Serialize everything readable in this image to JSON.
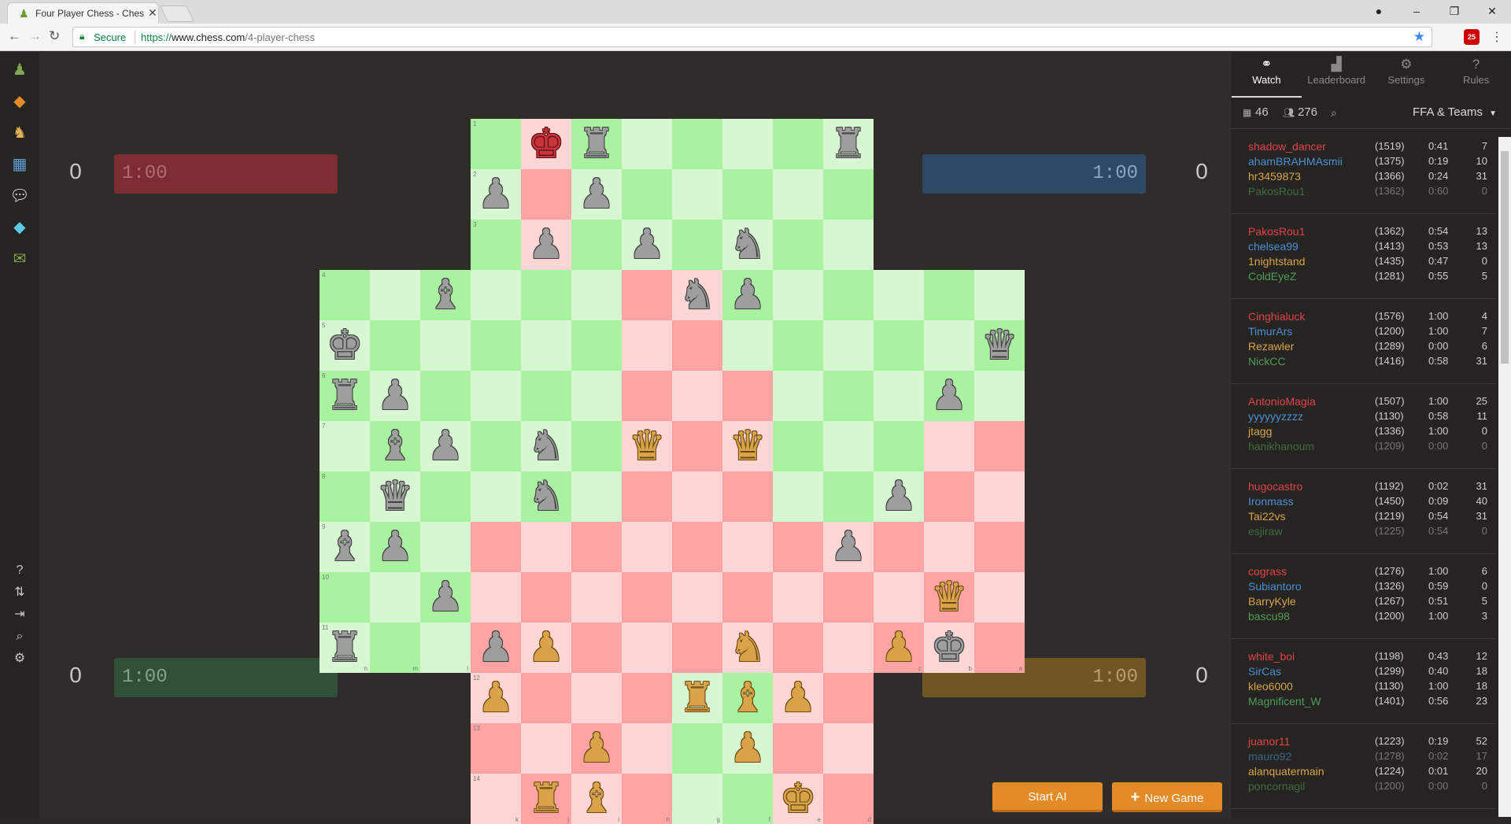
{
  "browser": {
    "tab_title": "Four Player Chess - Ches",
    "secure_label": "Secure",
    "url_scheme": "https://",
    "url_host": "www.chess.com",
    "url_path": "/4-player-chess",
    "abp_count": "25"
  },
  "scores": {
    "red": "0",
    "blue": "0",
    "green": "0",
    "yellow": "0"
  },
  "clocks": {
    "red": {
      "time": "1:00",
      "bg": "#7d2c32",
      "fg": "#b56a6f"
    },
    "blue": {
      "time": "1:00",
      "bg": "#2c4a66",
      "fg": "#88a6c2"
    },
    "green": {
      "time": "1:00",
      "bg": "#31503a",
      "fg": "#82a28c"
    },
    "yellow": {
      "time": "1:00",
      "bg": "#6e5722",
      "fg": "#b79f6b"
    }
  },
  "colors": {
    "light_green": "#d7f7d3",
    "dark_green": "#a8f2a0",
    "light_red": "#ffd6d6",
    "dark_red": "#ffa3a5",
    "accent": "#e38b26"
  },
  "buttons": {
    "start_ai": "Start AI",
    "new_game": "New Game",
    "new_game_icon": "+"
  },
  "right_tabs": [
    {
      "label": "Watch",
      "icon": "binoculars-icon",
      "glyph": "⚭"
    },
    {
      "label": "Leaderboard",
      "icon": "leaderboard-icon",
      "glyph": "▟"
    },
    {
      "label": "Settings",
      "icon": "gear-icon",
      "glyph": "⚙"
    },
    {
      "label": "Rules",
      "icon": "help-icon",
      "glyph": "?"
    }
  ],
  "stats": {
    "games": "46",
    "players": "276",
    "mode": "FFA & Teams"
  },
  "games": [
    [
      [
        "shadow_dancer",
        "(1519)",
        "0:41",
        "7"
      ],
      [
        "ahamBRAHMAsmii",
        "(1375)",
        "0:19",
        "10"
      ],
      [
        "hr3459873",
        "(1366)",
        "0:24",
        "31"
      ],
      [
        "PakosRou1",
        "(1362)",
        "0:60",
        "0"
      ]
    ],
    [
      [
        "PakosRou1",
        "(1362)",
        "0:54",
        "13"
      ],
      [
        "chelsea99",
        "(1413)",
        "0:53",
        "13"
      ],
      [
        "1nightstand",
        "(1435)",
        "0:47",
        "0"
      ],
      [
        "ColdEyeZ",
        "(1281)",
        "0:55",
        "5"
      ]
    ],
    [
      [
        "Cinghialuck",
        "(1576)",
        "1:00",
        "4"
      ],
      [
        "TimurArs",
        "(1200)",
        "1:00",
        "7"
      ],
      [
        "Rezawler",
        "(1289)",
        "0:00",
        "6"
      ],
      [
        "NickCC",
        "(1416)",
        "0:58",
        "31"
      ]
    ],
    [
      [
        "AntonioMagia",
        "(1507)",
        "1:00",
        "25"
      ],
      [
        "yyyyyyzzzz",
        "(1130)",
        "0:58",
        "11"
      ],
      [
        "jtagg",
        "(1336)",
        "1:00",
        "0"
      ],
      [
        "hanikhanoum",
        "(1209)",
        "0:00",
        "0"
      ]
    ],
    [
      [
        "hugocastro",
        "(1192)",
        "0:02",
        "31"
      ],
      [
        "Ironmass",
        "(1450)",
        "0:09",
        "40"
      ],
      [
        "Tai22vs",
        "(1219)",
        "0:54",
        "31"
      ],
      [
        "esjiraw",
        "(1225)",
        "0:54",
        "0"
      ]
    ],
    [
      [
        "cograss",
        "(1276)",
        "1:00",
        "6"
      ],
      [
        "Subiantoro",
        "(1326)",
        "0:59",
        "0"
      ],
      [
        "BarryKyle",
        "(1267)",
        "0:51",
        "5"
      ],
      [
        "bascu98",
        "(1200)",
        "1:00",
        "3"
      ]
    ],
    [
      [
        "white_boi",
        "(1198)",
        "0:43",
        "12"
      ],
      [
        "SirCas",
        "(1299)",
        "0:40",
        "18"
      ],
      [
        "kleo6000",
        "(1130)",
        "1:00",
        "18"
      ],
      [
        "Magnificent_W",
        "(1401)",
        "0:56",
        "23"
      ]
    ],
    [
      [
        "juanor11",
        "(1223)",
        "0:19",
        "52"
      ],
      [
        "mauro92",
        "(1278)",
        "0:02",
        "17"
      ],
      [
        "alanquatermain",
        "(1224)",
        "0:01",
        "20"
      ],
      [
        "poncornagil",
        "(1200)",
        "0:00",
        "0"
      ]
    ]
  ],
  "dim_rows": [
    [
      0,
      3
    ],
    [
      3,
      3
    ],
    [
      4,
      3
    ],
    [
      7,
      1
    ],
    [
      7,
      3
    ]
  ],
  "player_colors": [
    "#e0434b",
    "#4a8fd6",
    "#d9a34a",
    "#4f9c5b"
  ],
  "board": {
    "rank_labels": [
      "1",
      "2",
      "3",
      "4",
      "5",
      "6",
      "7",
      "8",
      "9",
      "10",
      "11",
      "12",
      "13",
      "14"
    ],
    "file_labels": [
      "n",
      "m",
      "l",
      "k",
      "j",
      "i",
      "h",
      "g",
      "f",
      "e",
      "d",
      "c",
      "b",
      "a"
    ],
    "pieces": [
      [
        0,
        4,
        "red",
        "king"
      ],
      [
        0,
        5,
        "grey",
        "rook"
      ],
      [
        0,
        10,
        "grey",
        "rook"
      ],
      [
        1,
        3,
        "grey",
        "pawn"
      ],
      [
        1,
        5,
        "grey",
        "pawn"
      ],
      [
        2,
        4,
        "grey",
        "pawn"
      ],
      [
        2,
        6,
        "grey",
        "pawn"
      ],
      [
        2,
        8,
        "grey",
        "knight"
      ],
      [
        3,
        2,
        "grey",
        "bishop"
      ],
      [
        3,
        7,
        "grey",
        "knight"
      ],
      [
        3,
        8,
        "grey",
        "pawn"
      ],
      [
        4,
        0,
        "grey",
        "king"
      ],
      [
        4,
        13,
        "grey",
        "queen"
      ],
      [
        5,
        0,
        "grey",
        "rook"
      ],
      [
        5,
        1,
        "grey",
        "pawn"
      ],
      [
        5,
        12,
        "grey",
        "pawn"
      ],
      [
        6,
        1,
        "grey",
        "bishop"
      ],
      [
        6,
        2,
        "grey",
        "pawn"
      ],
      [
        6,
        4,
        "grey",
        "knight"
      ],
      [
        6,
        6,
        "gold",
        "queen"
      ],
      [
        6,
        8,
        "gold",
        "queen"
      ],
      [
        7,
        1,
        "grey",
        "queen"
      ],
      [
        7,
        4,
        "grey",
        "knight"
      ],
      [
        7,
        11,
        "grey",
        "pawn"
      ],
      [
        8,
        0,
        "grey",
        "bishop"
      ],
      [
        8,
        1,
        "grey",
        "pawn"
      ],
      [
        8,
        10,
        "grey",
        "pawn"
      ],
      [
        9,
        2,
        "grey",
        "pawn"
      ],
      [
        9,
        12,
        "gold",
        "queen"
      ],
      [
        10,
        0,
        "grey",
        "rook"
      ],
      [
        10,
        3,
        "grey",
        "pawn"
      ],
      [
        10,
        4,
        "gold",
        "pawn"
      ],
      [
        10,
        8,
        "gold",
        "knight"
      ],
      [
        10,
        11,
        "gold",
        "pawn"
      ],
      [
        10,
        12,
        "grey",
        "king"
      ],
      [
        11,
        3,
        "gold",
        "pawn"
      ],
      [
        11,
        7,
        "gold",
        "rook"
      ],
      [
        11,
        8,
        "gold",
        "bishop"
      ],
      [
        11,
        9,
        "gold",
        "pawn"
      ],
      [
        12,
        5,
        "gold",
        "pawn"
      ],
      [
        12,
        8,
        "gold",
        "pawn"
      ],
      [
        13,
        4,
        "gold",
        "rook"
      ],
      [
        13,
        5,
        "gold",
        "bishop"
      ],
      [
        13,
        9,
        "gold",
        "king"
      ]
    ]
  }
}
